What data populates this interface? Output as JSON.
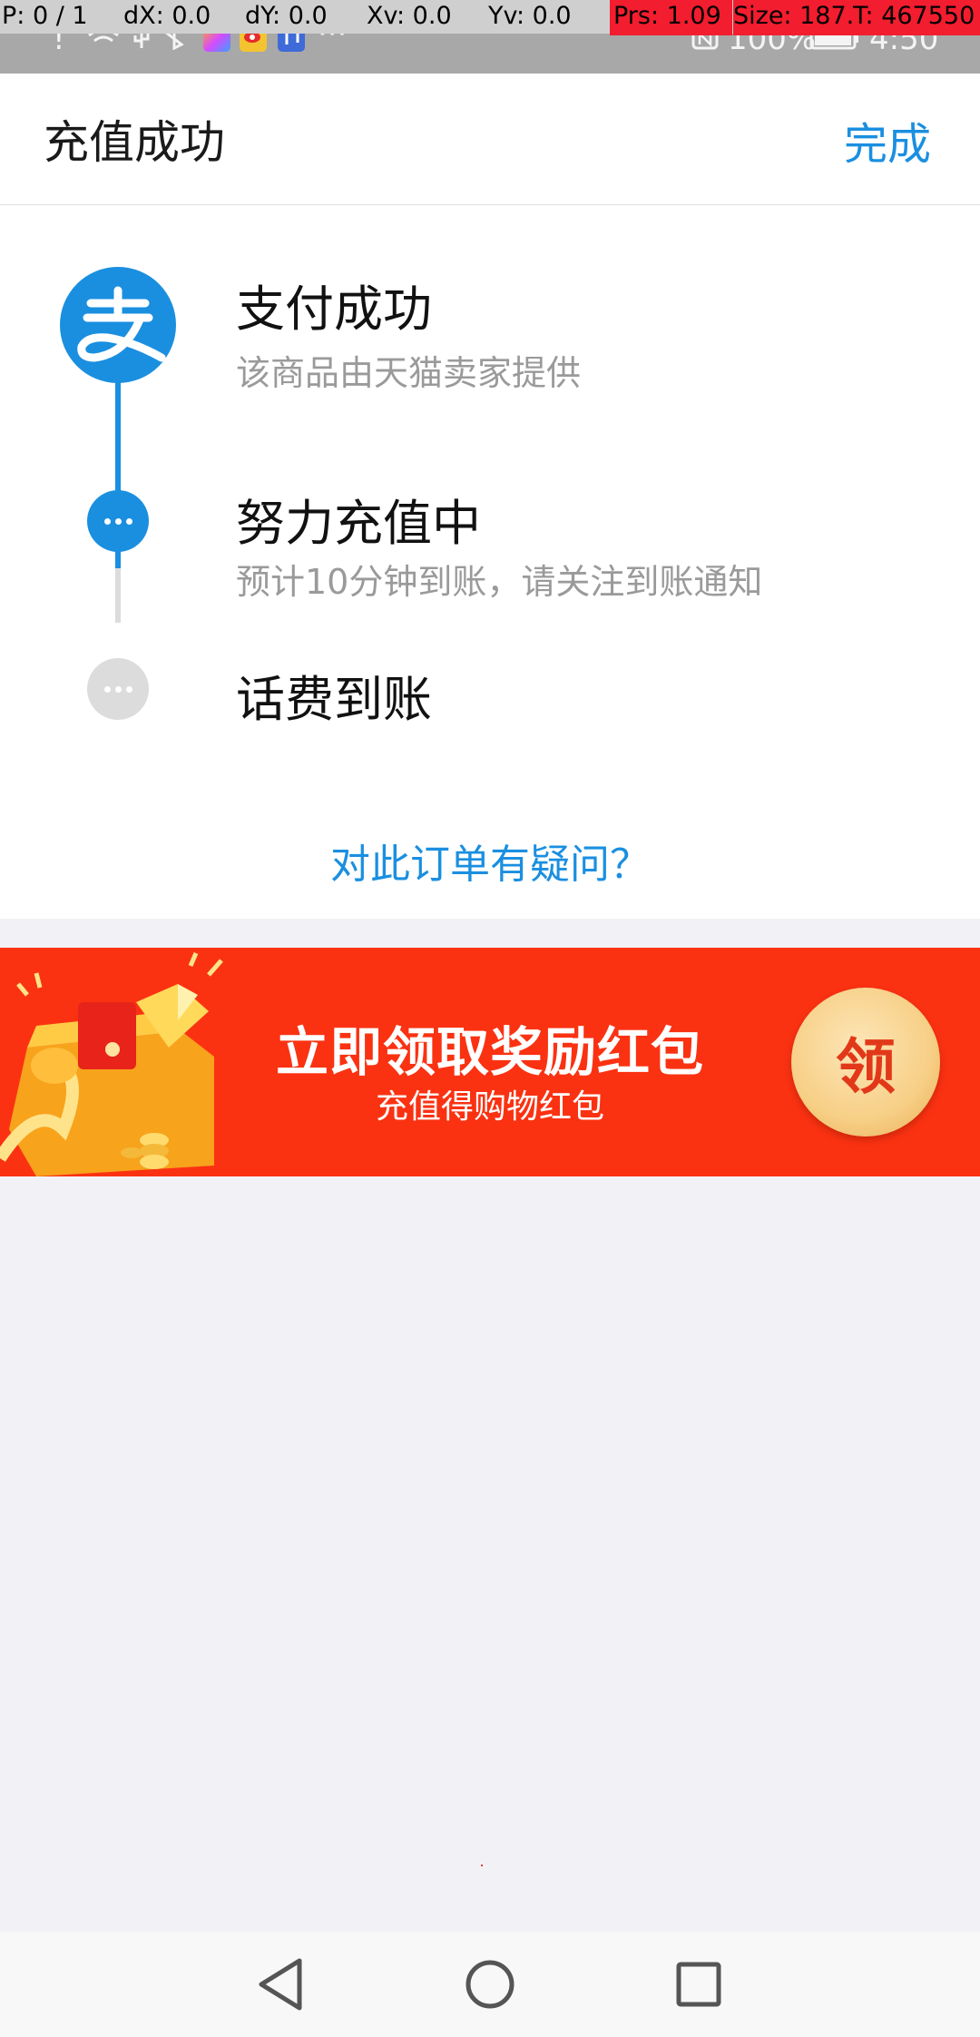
{
  "debug": {
    "pointer": "P: 0 / 1",
    "dx": "dX: 0.0",
    "dy": "dY: 0.0",
    "xv": "Xv: 0.0",
    "yv": "Yv: 0.0",
    "prs": "Prs: 1.09",
    "size": "Size: 187.",
    "t": "T: 467550"
  },
  "status_bar": {
    "battery": "100%",
    "time": "4:50",
    "icons": [
      "alert-icon",
      "wifi-icon",
      "usb-icon",
      "bluetooth-icon",
      "app-icon",
      "weibo-icon",
      "music-icon",
      "more-icon",
      "nfc-icon",
      "battery-icon"
    ]
  },
  "header": {
    "title": "充值成功",
    "done_label": "完成"
  },
  "steps": [
    {
      "title": "支付成功",
      "subtitle": "该商品由天猫卖家提供",
      "status": "done"
    },
    {
      "title": "努力充值中",
      "subtitle": "预计10分钟到账，请关注到账通知",
      "status": "in-progress"
    },
    {
      "title": "话费到账",
      "status": "pending"
    }
  ],
  "question_link": "对此订单有疑问？",
  "banner": {
    "title": "立即领取奖励红包",
    "subtitle": "充值得购物红包",
    "claim_label": "领"
  },
  "colors": {
    "accent": "#1a8fe0",
    "banner_red": "#fa3212",
    "pending_gray": "#dcdcdc"
  }
}
